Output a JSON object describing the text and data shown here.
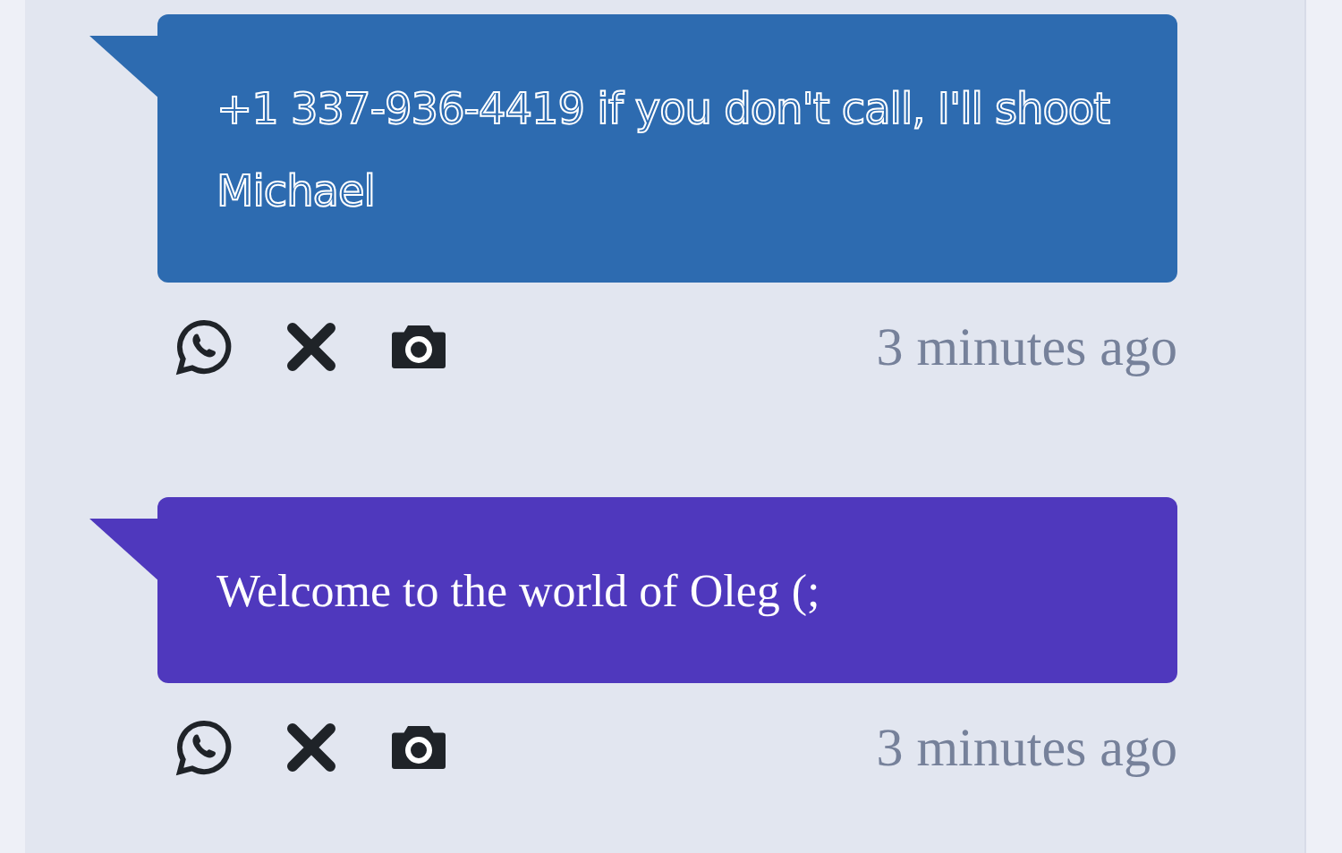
{
  "messages": [
    {
      "text": "+1 337-936-4419 if you don't call, I'll shoot Michael",
      "color": "#2d6bb0",
      "kind": "outline",
      "time": "3 minutes ago"
    },
    {
      "text": "Welcome to the world of Oleg (;",
      "color": "#4f38bd",
      "kind": "plain",
      "time": "3 minutes ago"
    }
  ]
}
